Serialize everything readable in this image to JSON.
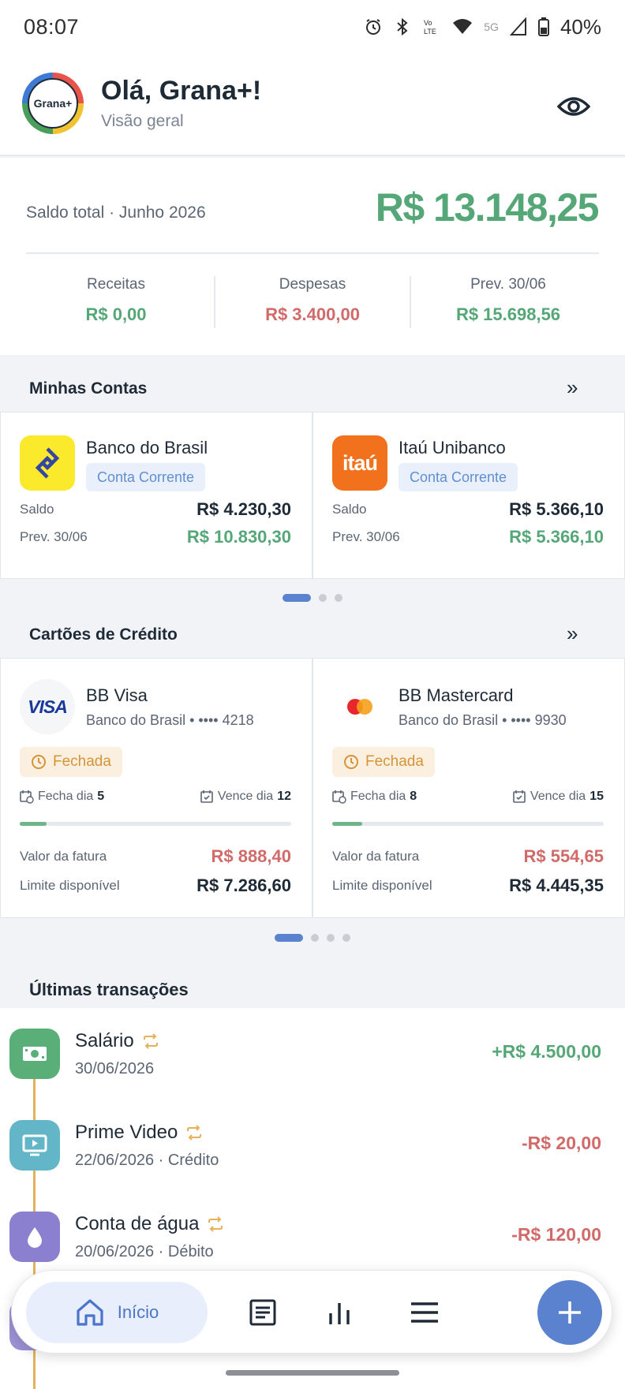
{
  "status_bar": {
    "time": "08:07",
    "network": "5G",
    "battery": "40%"
  },
  "header": {
    "logo_text": "Grana+",
    "greeting": "Olá, Grana+!",
    "subtitle": "Visão geral"
  },
  "balance": {
    "label": "Saldo total · Junho 2026",
    "value": "R$ 13.148,25",
    "metrics": [
      {
        "label": "Receitas",
        "value": "R$ 0,00",
        "color": "#55a777"
      },
      {
        "label": "Despesas",
        "value": "R$ 3.400,00",
        "color": "#d26a6a"
      },
      {
        "label": "Prev. 30/06",
        "value": "R$ 15.698,56",
        "color": "#55a777"
      }
    ]
  },
  "accounts": {
    "title": "Minhas Contas",
    "more": "»",
    "items": [
      {
        "name": "Banco do Brasil",
        "type": "Conta Corrente",
        "saldo_label": "Saldo",
        "saldo": "R$ 4.230,30",
        "prev_label": "Prev. 30/06",
        "prev": "R$ 10.830,30"
      },
      {
        "name": "Itaú Unibanco",
        "type": "Conta Corrente",
        "logo_text": "itaú",
        "saldo_label": "Saldo",
        "saldo": "R$ 5.366,10",
        "prev_label": "Prev. 30/06",
        "prev": "R$ 5.366,10"
      }
    ]
  },
  "cards": {
    "title": "Cartões de Crédito",
    "more": "»",
    "items": [
      {
        "name": "BB Visa",
        "sub": "Banco do Brasil • •••• 4218",
        "logo_text": "VISA",
        "status": "Fechada",
        "fecha_label": "Fecha dia",
        "fecha": "5",
        "vence_label": "Vence dia",
        "vence": "12",
        "progress": 0.1,
        "fatura_label": "Valor da fatura",
        "fatura": "R$ 888,40",
        "limite_label": "Limite disponível",
        "limite": "R$ 7.286,60"
      },
      {
        "name": "BB Mastercard",
        "sub": "Banco do Brasil • •••• 9930",
        "status": "Fechada",
        "fecha_label": "Fecha dia",
        "fecha": "8",
        "vence_label": "Vence dia",
        "vence": "15",
        "progress": 0.11,
        "fatura_label": "Valor da fatura",
        "fatura": "R$ 554,65",
        "limite_label": "Limite disponível",
        "limite": "R$ 4.445,35"
      }
    ]
  },
  "transactions": {
    "title": "Últimas transações",
    "items": [
      {
        "name": "Salário",
        "date": "30/06/2026",
        "amount": "+R$ 4.500,00",
        "color": "#55a777",
        "icon_color": "#5aae78",
        "icon": "money-icon"
      },
      {
        "name": "Prime Video",
        "date": "22/06/2026 · Crédito",
        "amount": "-R$ 20,00",
        "color": "#d26a6a",
        "icon_color": "#62b6c8",
        "icon": "tv-icon"
      },
      {
        "name": "Conta de água",
        "date": "20/06/2026 · Débito",
        "amount": "-R$ 120,00",
        "color": "#d26a6a",
        "icon_color": "#8b7fcf",
        "icon": "water-drop-icon"
      }
    ]
  },
  "nav": {
    "home_label": "Início"
  },
  "colors": {
    "accent": "#5b82cf",
    "positive": "#55a777",
    "negative": "#d26a6a",
    "warning": "#d69438"
  }
}
